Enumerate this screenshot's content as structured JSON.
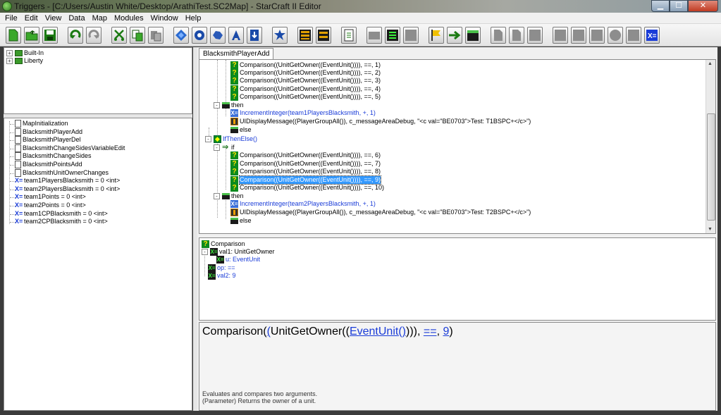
{
  "window": {
    "title": "Triggers - [C:/Users/Austin White/Desktop/ArathiTest.SC2Map] - StarCraft II Editor",
    "controls": {
      "minimize": "▁",
      "maximize": "☐",
      "close": "✕"
    }
  },
  "menu": [
    "File",
    "Edit",
    "View",
    "Data",
    "Map",
    "Modules",
    "Window",
    "Help"
  ],
  "toolbar": {
    "buttons": [
      {
        "icon": "new-map-icon"
      },
      {
        "icon": "open-folder-icon"
      },
      {
        "icon": "save-icon"
      },
      {
        "icon": "undo-icon"
      },
      {
        "icon": "redo-icon"
      },
      {
        "icon": "cut-icon"
      },
      {
        "icon": "copy-icon"
      },
      {
        "icon": "paste-icon"
      },
      {
        "icon": "terrain-module-icon"
      },
      {
        "icon": "triggers-module-icon"
      },
      {
        "icon": "data-module-icon"
      },
      {
        "icon": "text-module-icon"
      },
      {
        "icon": "import-module-icon"
      },
      {
        "icon": "cutscene-module-icon"
      },
      {
        "icon": "ai-module-icon"
      },
      {
        "icon": "ui-module-icon"
      },
      {
        "icon": "sound-module-icon"
      },
      {
        "icon": "new-folder-icon"
      },
      {
        "icon": "new-trigger-icon"
      },
      {
        "icon": "new-action-definition-icon"
      },
      {
        "icon": "new-event-icon"
      },
      {
        "icon": "new-condition-icon"
      },
      {
        "icon": "new-action-icon"
      },
      {
        "icon": "new-comment-icon"
      },
      {
        "icon": "new-variable-icon"
      }
    ]
  },
  "left_top_tree": [
    {
      "label": "Built-In"
    },
    {
      "label": "Liberty"
    }
  ],
  "left_list": [
    {
      "label": "MapInitialization",
      "kind": "trigger"
    },
    {
      "label": "BlacksmithPlayerAdd",
      "kind": "trigger"
    },
    {
      "label": "BlacksmithPlayerDel",
      "kind": "trigger"
    },
    {
      "label": "BlacksmithChangeSidesVariableEdit",
      "kind": "trigger"
    },
    {
      "label": "BlacksmithChangeSides",
      "kind": "trigger"
    },
    {
      "label": "BlacksmithPointsAdd",
      "kind": "trigger"
    },
    {
      "label": "BlacksmithUnitOwnerChanges",
      "kind": "trigger"
    },
    {
      "label": "team1PlayersBlacksmith = 0 <int>",
      "kind": "variable"
    },
    {
      "label": "team2PlayersBlacksmith = 0 <int>",
      "kind": "variable"
    },
    {
      "label": "team1Points = 0 <int>",
      "kind": "variable"
    },
    {
      "label": "team2Points = 0 <int>",
      "kind": "variable"
    },
    {
      "label": "team1CPBlacksmith = 0 <int>",
      "kind": "variable"
    },
    {
      "label": "team2CPBlacksmith = 0 <int>",
      "kind": "variable"
    }
  ],
  "tab": {
    "label": "BlacksmithPlayerAdd"
  },
  "trigger_tree": [
    {
      "label": "Comparison((UnitGetOwner((EventUnit()))), ==, 1)",
      "icon": "q"
    },
    {
      "label": "Comparison((UnitGetOwner((EventUnit()))), ==, 2)",
      "icon": "q"
    },
    {
      "label": "Comparison((UnitGetOwner((EventUnit()))), ==, 3)",
      "icon": "q"
    },
    {
      "label": "Comparison((UnitGetOwner((EventUnit()))), ==, 4)",
      "icon": "q"
    },
    {
      "label": "Comparison((UnitGetOwner((EventUnit()))), ==, 5)",
      "icon": "q"
    },
    {
      "label": "then",
      "icon": "clap"
    },
    {
      "label": "IncrementInteger(team1PlayersBlacksmith, +, 1)",
      "icon": "xb",
      "blue": true
    },
    {
      "label": "UIDisplayMessage((PlayerGroupAll()), c_messageAreaDebug, \"<c val=\"BE0703\">Test: T1BSPC+</c>\")",
      "icon": "ui"
    },
    {
      "label": "else",
      "icon": "clap"
    },
    {
      "label": "IfThenElse()",
      "icon": "ifelse",
      "blue": true
    },
    {
      "label": "if",
      "icon": "arrow"
    },
    {
      "label": "Comparison((UnitGetOwner((EventUnit()))), ==, 6)",
      "icon": "q"
    },
    {
      "label": "Comparison((UnitGetOwner((EventUnit()))), ==, 7)",
      "icon": "q"
    },
    {
      "label": "Comparison((UnitGetOwner((EventUnit()))), ==, 8)",
      "icon": "q"
    },
    {
      "label": "Comparison((UnitGetOwner((EventUnit()))), ==, 9)",
      "icon": "q",
      "selected": true
    },
    {
      "label": "Comparison((UnitGetOwner((EventUnit()))), ==, 10)",
      "icon": "q"
    },
    {
      "label": "then",
      "icon": "clap"
    },
    {
      "label": "IncrementInteger(team2PlayersBlacksmith, +, 1)",
      "icon": "xb",
      "blue": true
    },
    {
      "label": "UIDisplayMessage((PlayerGroupAll()), c_messageAreaDebug, \"<c val=\"BE0703\">Test: T2BSPC+</c>\")",
      "icon": "ui"
    },
    {
      "label": "else",
      "icon": "clap"
    }
  ],
  "node_tree": [
    {
      "label": "Comparison",
      "icon": "q"
    },
    {
      "label": "val1: UnitGetOwner",
      "icon": "x"
    },
    {
      "label": "u: EventUnit",
      "icon": "x",
      "blue": true
    },
    {
      "label": "op: ==",
      "icon": "x",
      "blue": true
    },
    {
      "label": "val2: 9",
      "icon": "x",
      "blue": true
    }
  ],
  "info": {
    "title_prefix": "Comparison(",
    "title_paren1": "(",
    "title_fn": "UnitGetOwner(",
    "title_paren2": "(",
    "title_link1": "EventUnit()",
    "title_close": "))),",
    "title_link2": "==",
    "title_comma": ",",
    "title_link3": "9",
    "title_end": ")",
    "description_line1": "Evaluates and compares two arguments.",
    "description_line2": "(Parameter) Returns the owner of a unit."
  }
}
